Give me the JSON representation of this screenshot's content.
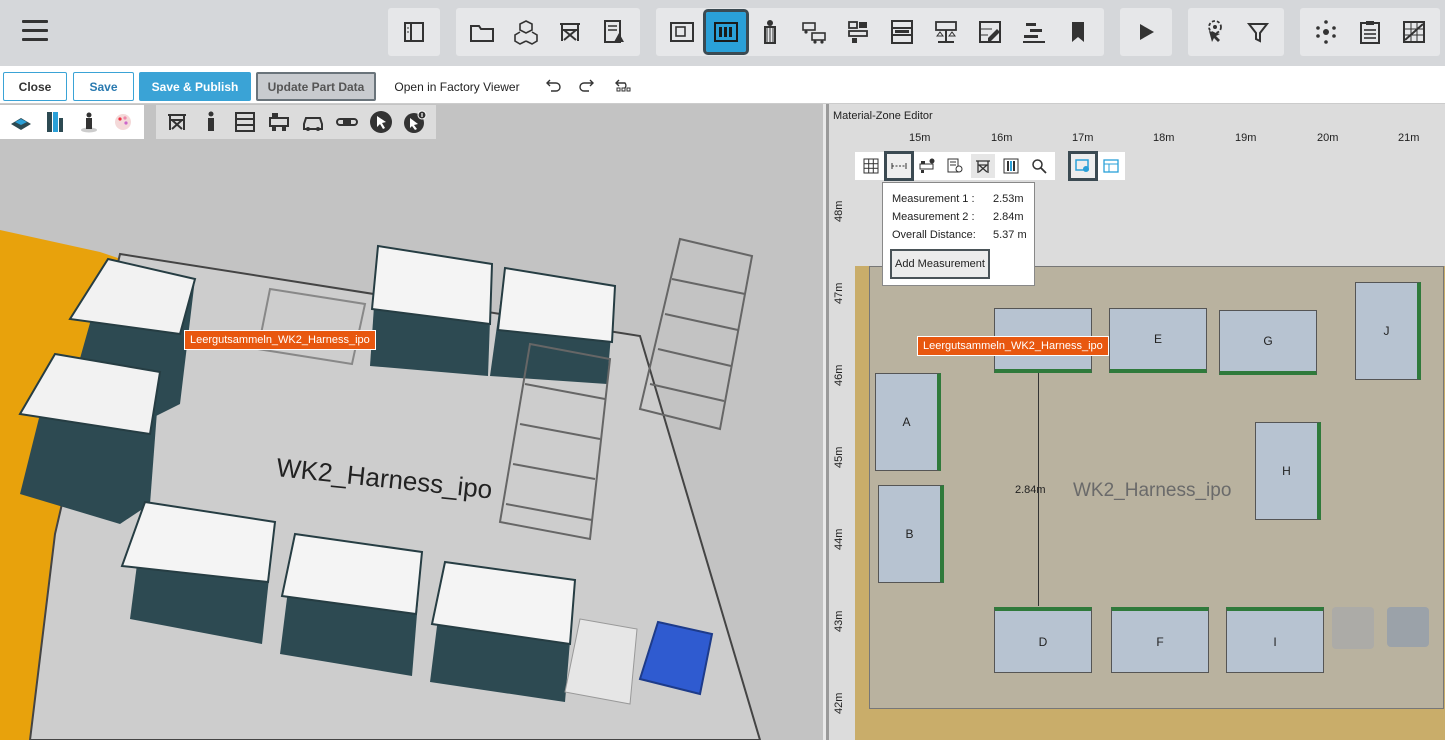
{
  "topbar": {
    "groups": [
      {
        "buttons": [
          "panel-icon"
        ]
      },
      {
        "buttons": [
          "folder-icon",
          "boxes-icon",
          "rack-icon",
          "document-warning-icon"
        ]
      },
      {
        "buttons": [
          "layout-frame-icon",
          "material-zone-icon",
          "worker-icon",
          "vehicles-icon",
          "station-icon",
          "shelf-icon",
          "balance-icon",
          "edit-grid-icon",
          "gantt-icon",
          "bookmark-icon"
        ]
      },
      {
        "buttons": [
          "play-icon"
        ]
      },
      {
        "buttons": [
          "cursor-eye-icon",
          "filter-icon"
        ]
      },
      {
        "buttons": [
          "network-icon",
          "clipboard-icon",
          "chart-grid-icon"
        ]
      }
    ],
    "active": "material-zone-icon"
  },
  "actions": {
    "close": "Close",
    "save": "Save",
    "save_publish": "Save & Publish",
    "update_part": "Update Part Data",
    "open_viewer": "Open in Factory Viewer"
  },
  "view3d": {
    "zone_label": "WK2_Harness_ipo",
    "tag": "Leergutsammeln_WK2_Harness_ipo"
  },
  "editor": {
    "title": "Material-Zone Editor",
    "ruler_x": [
      "15m",
      "16m",
      "17m",
      "18m",
      "19m",
      "20m",
      "21m"
    ],
    "ruler_y": [
      "48m",
      "47m",
      "46m",
      "45m",
      "44m",
      "43m",
      "42m"
    ],
    "measurement": {
      "m1_label": "Measurement 1 :",
      "m1_value": "2.53m",
      "m2_label": "Measurement 2 :",
      "m2_value": "2.84m",
      "overall_label": "Overall Distance:",
      "overall_value": "5.37 m",
      "add_button": "Add Measurement"
    },
    "tag": "Leergutsammeln_WK2_Harness_ipo",
    "zone_label": "WK2_Harness_ipo",
    "dimension": "2.84m",
    "zones": {
      "a": "A",
      "b": "B",
      "d": "D",
      "e": "E",
      "f": "F",
      "g": "G",
      "h": "H",
      "i": "I",
      "j": "J"
    }
  },
  "colors": {
    "accent": "#2aa0d8",
    "tag": "#e8570f",
    "floor": "#b9b29f",
    "zone": "#b7c3d1",
    "orange_floor": "#e8a20c"
  }
}
